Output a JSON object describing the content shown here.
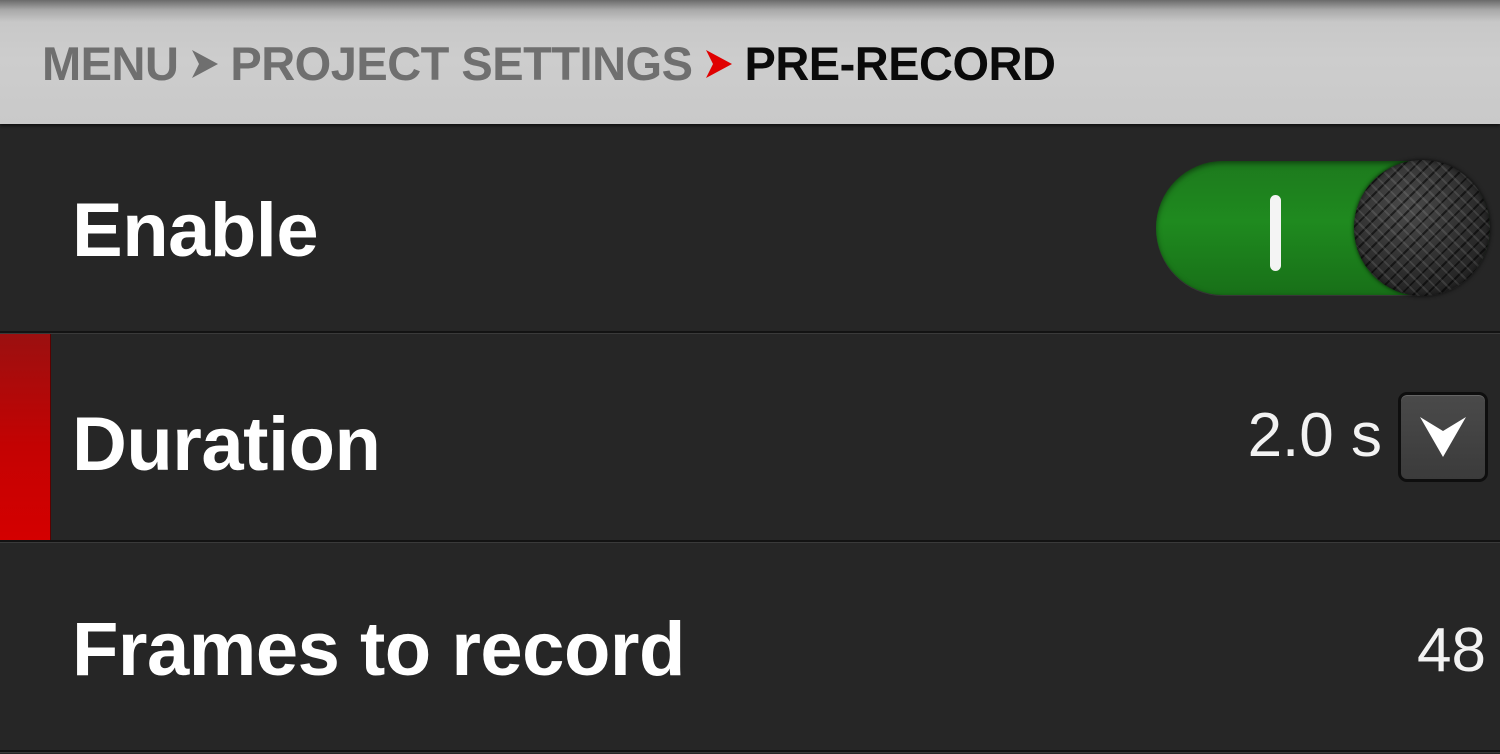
{
  "breadcrumb": {
    "items": [
      "MENU",
      "PROJECT SETTINGS",
      "PRE-RECORD"
    ],
    "current": "PRE-RECORD",
    "separator_icons": [
      "chevron-right-icon",
      "chevron-right-icon"
    ],
    "colors": {
      "inactive": "#6f6f6f",
      "active": "#0a0a0a",
      "inactive_chevron": "#6f6f6f",
      "active_chevron": "#e00000"
    }
  },
  "settings": [
    {
      "label": "Enable",
      "control": "toggle",
      "state": "on",
      "on_mark": "I",
      "accent": "#1f8a1f"
    },
    {
      "label": "Duration",
      "control": "dropdown",
      "value": "2.0 s",
      "selected": true,
      "icon": "chevron-down-icon",
      "accent": "#c40202"
    },
    {
      "label": "Frames to record",
      "control": "readonly",
      "value": "48"
    }
  ]
}
